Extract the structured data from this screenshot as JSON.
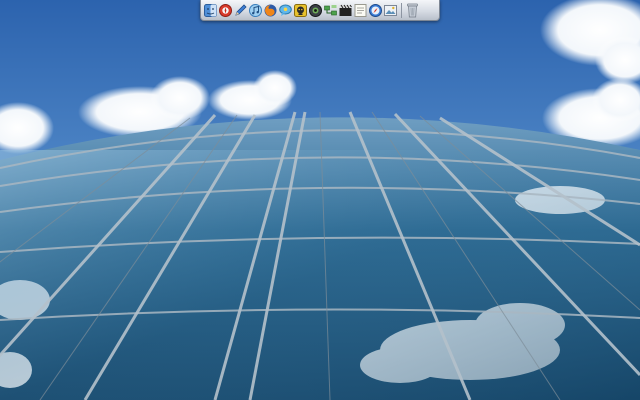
{
  "desktop": {
    "wallpaper": "glass-building-facade-with-clouds",
    "sky_color": "#3b74bd",
    "glass_color": "#1f5a82"
  },
  "dock": {
    "position": "top",
    "apps": [
      {
        "icon": "finder-icon"
      },
      {
        "icon": "safari-icon"
      },
      {
        "icon": "pencil-icon"
      },
      {
        "icon": "itunes-icon"
      },
      {
        "icon": "firefox-icon"
      },
      {
        "icon": "chat-icon"
      },
      {
        "icon": "pirate-icon"
      },
      {
        "icon": "eye-icon"
      },
      {
        "icon": "network-icon"
      },
      {
        "icon": "clapperboard-icon"
      },
      {
        "icon": "notes-icon"
      },
      {
        "icon": "compass-icon"
      },
      {
        "icon": "image-icon"
      }
    ],
    "trash": {
      "icon": "trash-icon"
    }
  }
}
